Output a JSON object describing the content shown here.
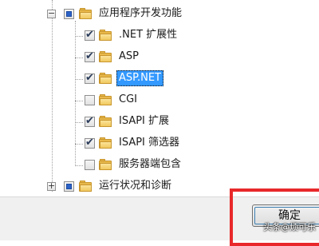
{
  "tree": {
    "parent": {
      "label": "应用程序开发功能",
      "state": "partial",
      "expanded": true
    },
    "children": [
      {
        "label": ".NET 扩展性",
        "checked": true,
        "selected": false
      },
      {
        "label": "ASP",
        "checked": true,
        "selected": false
      },
      {
        "label": "ASP.NET",
        "checked": true,
        "selected": true
      },
      {
        "label": "CGI",
        "checked": false,
        "selected": false
      },
      {
        "label": "ISAPI 扩展",
        "checked": true,
        "selected": false
      },
      {
        "label": "ISAPI 筛选器",
        "checked": true,
        "selected": false
      },
      {
        "label": "服务器端包含",
        "checked": false,
        "selected": false
      }
    ],
    "next": {
      "label": "运行状况和诊断",
      "state": "partial",
      "expanded": false
    }
  },
  "dialog": {
    "ok_label": "确定"
  },
  "watermark": {
    "text": "头条@烦可乐"
  },
  "colors": {
    "highlight": "#e8282a",
    "selection": "#3399ff"
  }
}
